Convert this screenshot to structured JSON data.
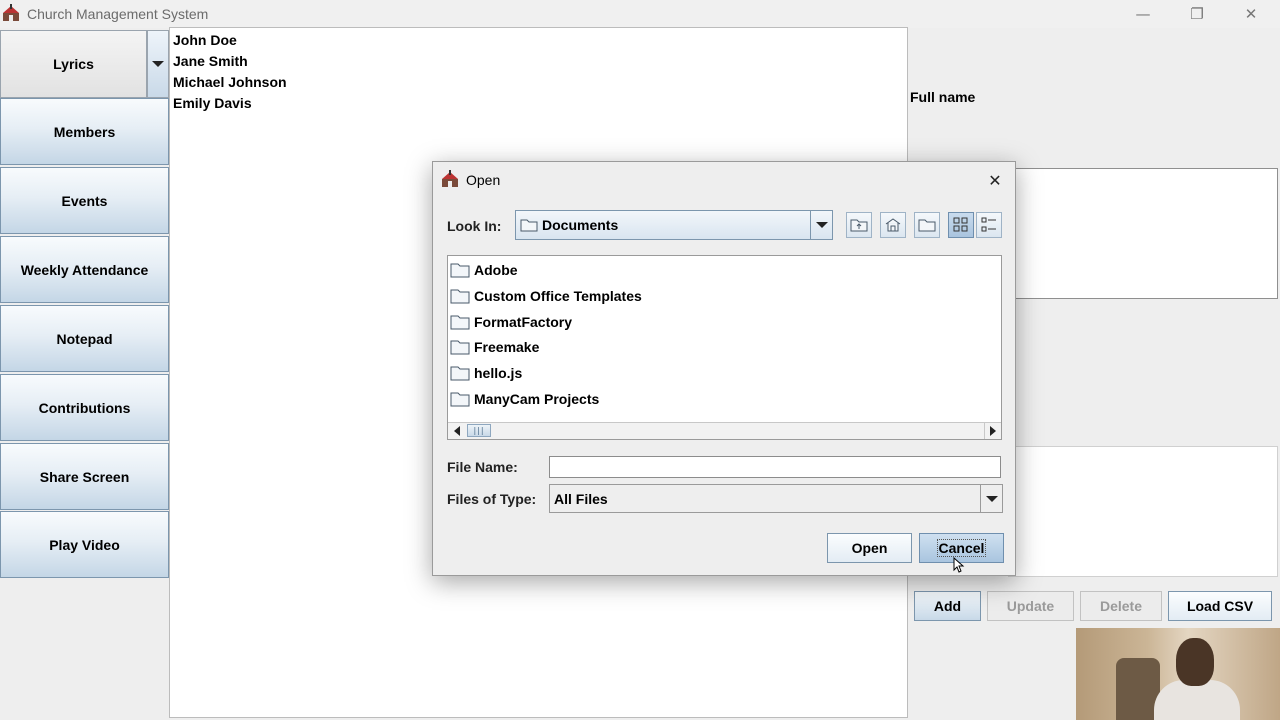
{
  "window": {
    "title": "Church Management System",
    "minimize_icon": "—",
    "maximize_icon": "❐",
    "close_icon": "✕"
  },
  "nav": {
    "lyrics": "Lyrics",
    "items": [
      {
        "label": "Members"
      },
      {
        "label": "Events"
      },
      {
        "label": "Weekly Attendance"
      },
      {
        "label": "Notepad"
      },
      {
        "label": "Contributions"
      },
      {
        "label": "Share Screen"
      },
      {
        "label": "Play Video"
      }
    ]
  },
  "names": [
    "John Doe",
    "Jane Smith",
    "Michael Johnson",
    "Emily Davis"
  ],
  "right_panel": {
    "full_name_label": "Full name",
    "buttons": {
      "add": "Add",
      "update": "Update",
      "delete": "Delete",
      "load_csv": "Load CSV"
    }
  },
  "dialog": {
    "title": "Open",
    "close_icon": "✕",
    "look_in_label": "Look In:",
    "look_in_value": "Documents",
    "files": [
      {
        "name": "Adobe"
      },
      {
        "name": "Custom Office Templates"
      },
      {
        "name": "FormatFactory"
      },
      {
        "name": "Freemake"
      },
      {
        "name": "hello.js"
      },
      {
        "name": "ManyCam Projects"
      }
    ],
    "file_name_label": "File Name:",
    "file_name_value": "",
    "files_of_type_label": "Files of Type:",
    "files_of_type_value": "All Files",
    "open_button": "Open",
    "cancel_button": "Cancel",
    "scroll_thumb_glyph": "|||"
  },
  "colors": {
    "accent_button_top": "#f8fbfd",
    "accent_button_bottom": "#c4d6e6",
    "border_blue": "#7c96ad",
    "disabled_text": "#9a9a9a"
  }
}
